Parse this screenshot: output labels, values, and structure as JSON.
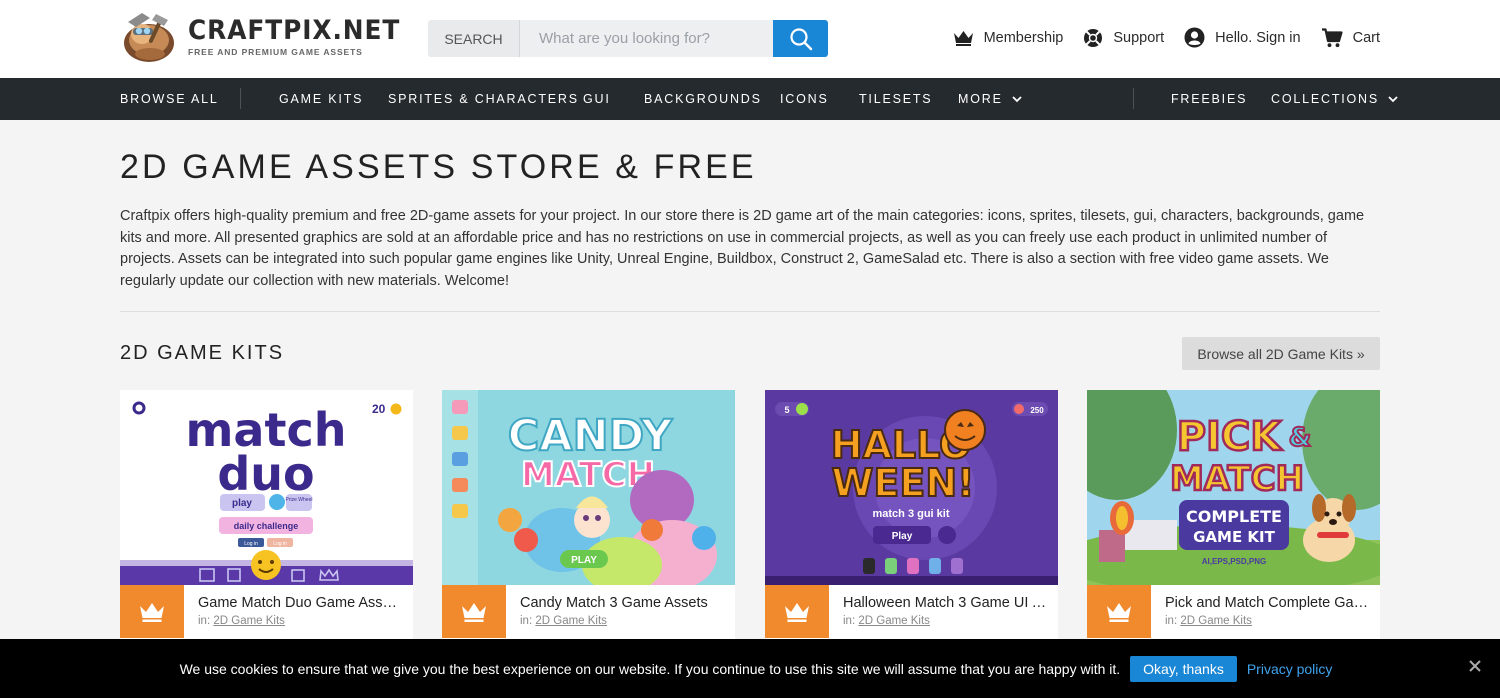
{
  "brand": {
    "name": "CRAFTPIX.NET",
    "tagline": "FREE AND PREMIUM GAME ASSETS"
  },
  "search": {
    "label": "SEARCH",
    "placeholder": "What are you looking for?",
    "icon": "search-icon"
  },
  "user_nav": {
    "membership": "Membership",
    "support": "Support",
    "signin": "Hello. Sign in",
    "cart": "Cart"
  },
  "nav": {
    "browse_all": "BROWSE ALL",
    "game_kits": "GAME KITS",
    "sprites": "SPRITES & CHARACTERS",
    "gui": "GUI",
    "backgrounds": "BACKGROUNDS",
    "icons": "ICONS",
    "tilesets": "TILESETS",
    "more": "MORE",
    "freebies": "FREEBIES",
    "collections": "COLLECTIONS"
  },
  "main": {
    "title": "2D GAME ASSETS STORE & FREE",
    "intro": "Craftpix offers high-quality premium and free 2D-game assets for your project. In our store there is 2D game art of the main categories: icons, sprites, tilesets, gui, characters, backgrounds, game kits and more. All presented graphics are sold at an affordable price and has no restrictions on use in commercial projects, as well as you can freely use each product in unlimited number of projects. Assets can be integrated into such popular game engines like Unity, Unreal Engine, Buildbox, Construct 2, GameSalad etc. There is also a section with free video game assets. We regularly update our collection with new materials. Welcome!"
  },
  "section": {
    "title": "2D GAME KITS",
    "browse_label": "Browse all 2D Game Kits »"
  },
  "cards": [
    {
      "name": "Game Match Duo Game Assets ...",
      "in_label": "in:",
      "category": "2D Game Kits",
      "thumb": {
        "line1": "match",
        "line2": "duo",
        "play": "play",
        "prize": "Prize Wheel",
        "challenge": "daily challenge",
        "login1": "Log in",
        "login2": "Log in",
        "coins": "20"
      }
    },
    {
      "name": "Candy Match 3 Game Assets",
      "in_label": "in:",
      "category": "2D Game Kits",
      "thumb": {
        "line1": "CANDY",
        "line2": "MATCH",
        "play": "PLAY"
      }
    },
    {
      "name": "Halloween Match 3 Game UI As...",
      "in_label": "in:",
      "category": "2D Game Kits",
      "thumb": {
        "line1": "HALLO",
        "line2": "WEEN!",
        "sub": "match 3 gui kit",
        "play": "Play",
        "lives": "5",
        "coins": "250"
      }
    },
    {
      "name": "Pick and Match Complete Gam...",
      "in_label": "in:",
      "category": "2D Game Kits",
      "thumb": {
        "line1": "PICK",
        "amp": "&",
        "line2": "MATCH",
        "line3": "COMPLETE",
        "line4": "GAME KIT",
        "formats": "AI,EPS,PSD,PNG"
      }
    }
  ],
  "cookie": {
    "message": "We use cookies to ensure that we give you the best experience on our website. If you continue to use this site we will assume that you are happy with it.",
    "ok": "Okay, thanks",
    "privacy": "Privacy policy"
  },
  "colors": {
    "accent_blue": "#1a86d6",
    "nav_bg": "#252a2e",
    "badge_orange": "#f1892d",
    "page_bg": "#f4f4f4"
  }
}
